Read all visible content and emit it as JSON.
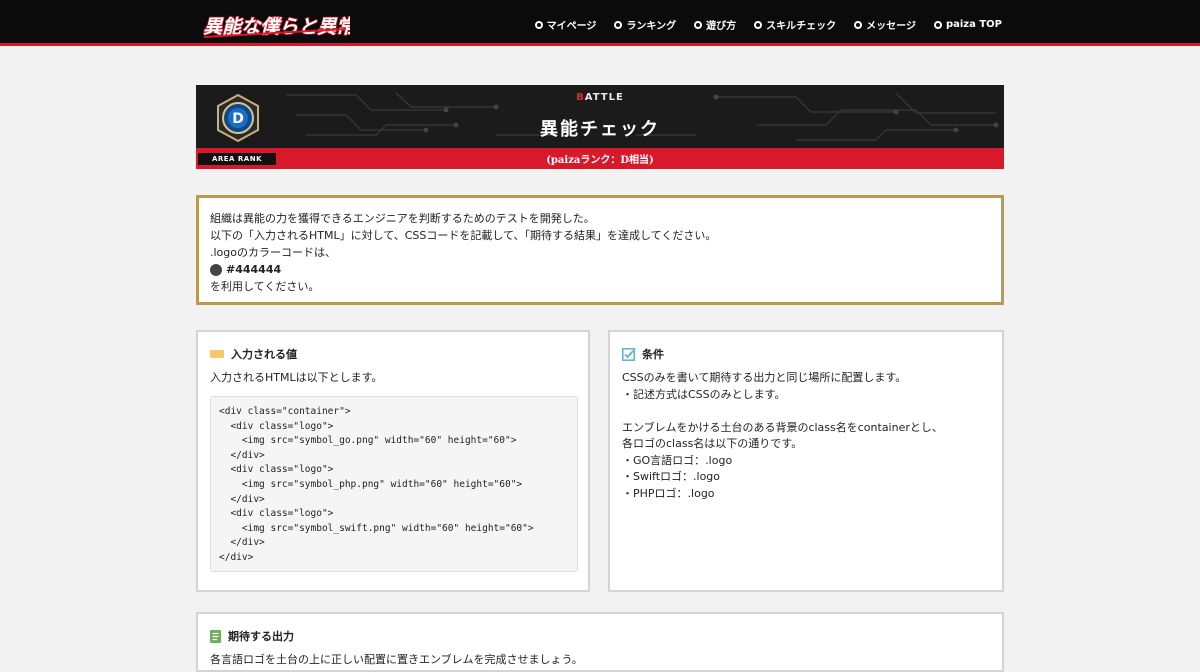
{
  "header": {
    "logo_text": "異能な僕らと異常な世界",
    "nav": [
      {
        "label": "マイページ"
      },
      {
        "label": "ランキング"
      },
      {
        "label": "遊び方"
      },
      {
        "label": "スキルチェック"
      },
      {
        "label": "メッセージ"
      },
      {
        "label": "paiza TOP"
      }
    ]
  },
  "banner": {
    "battle_first": "B",
    "battle_rest": "ATTLE",
    "title": "異能チェック",
    "subtitle": "(paizaランク：D相当)",
    "area_rank": "AREA RANK",
    "rank_letter": "D"
  },
  "description": {
    "line1": "組織は異能の力を獲得できるエンジニアを判断するためのテストを開発した。",
    "line2": "以下の「入力されるHTML」に対して、CSSコードを記載して、「期待する結果」を達成してください。",
    "line3": ".logoのカラーコードは、",
    "color_code": "#444444",
    "line4": "を利用してください。"
  },
  "input_panel": {
    "title": "入力される値",
    "intro": "入力されるHTMLは以下とします。",
    "code": "<div class=\"container\">\n  <div class=\"logo\">\n    <img src=\"symbol_go.png\" width=\"60\" height=\"60\">\n  </div>\n  <div class=\"logo\">\n    <img src=\"symbol_php.png\" width=\"60\" height=\"60\">\n  </div>\n  <div class=\"logo\">\n    <img src=\"symbol_swift.png\" width=\"60\" height=\"60\">\n  </div>\n</div>"
  },
  "condition_panel": {
    "title": "条件",
    "text": "CSSのみを書いて期待する出力と同じ場所に配置します。\n・記述方式はCSSのみとします。\n\nエンブレムをかける土台のある背景のclass名をcontainerとし、\n各ロゴのclass名は以下の通りです。\n・GO言語ロゴ：.logo\n・Swiftロゴ：.logo\n・PHPロゴ：.logo"
  },
  "expected_panel": {
    "title": "期待する出力",
    "text": "各言語ロゴを土台の上に正しい配置に置きエンブレムを完成させましょう。"
  },
  "colors": {
    "accent_red": "#d8192b",
    "gold_border": "#b99a4e",
    "logo_color": "#444444"
  }
}
